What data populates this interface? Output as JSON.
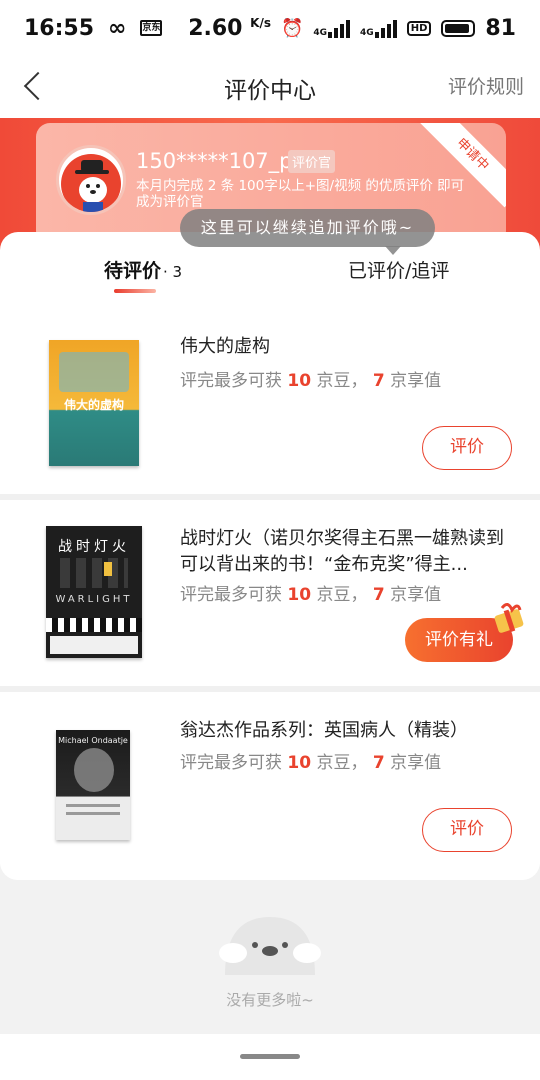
{
  "status_bar": {
    "time": "16:55",
    "infinity_glyph": "∞",
    "app_badge": "京东",
    "net_speed": "2.60",
    "net_speed_unit": "K/s",
    "alarm_glyph": "⏰",
    "network_4g_a": "4G",
    "network_4g_b": "4G",
    "hd_label": "HD",
    "battery": "81"
  },
  "nav": {
    "title": "评价中心",
    "rules_link": "评价规则"
  },
  "reviewer_card": {
    "user_id": "150*****107_p",
    "badge": "评价官",
    "description": "本月内完成 2 条 100字以上+图/视频 的优质评价 即可成为评价官",
    "corner_status": "申请中"
  },
  "tooltip": "这里可以继续追加评价哦~",
  "tabs": {
    "pending_label": "待评价",
    "pending_count": "· 3",
    "done_label": "已评价/追评"
  },
  "reward_text": {
    "prefix": "评完最多可获",
    "bean_unit": "京豆，",
    "enjoy_unit": "京享值"
  },
  "products": [
    {
      "title": "伟大的虚构",
      "beans": "10",
      "enjoy": "7",
      "button": "评价",
      "cover_title": "伟大的虚构"
    },
    {
      "title": "战时灯火（诺贝尔奖得主石黑一雄熟读到可以背出来的书！“金布克奖”得主...",
      "beans": "10",
      "enjoy": "7",
      "button": "评价有礼",
      "cover_title": "战时灯火",
      "cover_subtitle": "WARLIGHT"
    },
    {
      "title": "翁达杰作品系列：英国病人（精装）",
      "beans": "10",
      "enjoy": "7",
      "button": "评价",
      "cover_title": "Michael Ondaatje"
    }
  ],
  "footer": {
    "no_more": "没有更多啦~"
  },
  "colors": {
    "accent": "#e9432e",
    "banner": "#f04a38",
    "muted": "#888888"
  }
}
